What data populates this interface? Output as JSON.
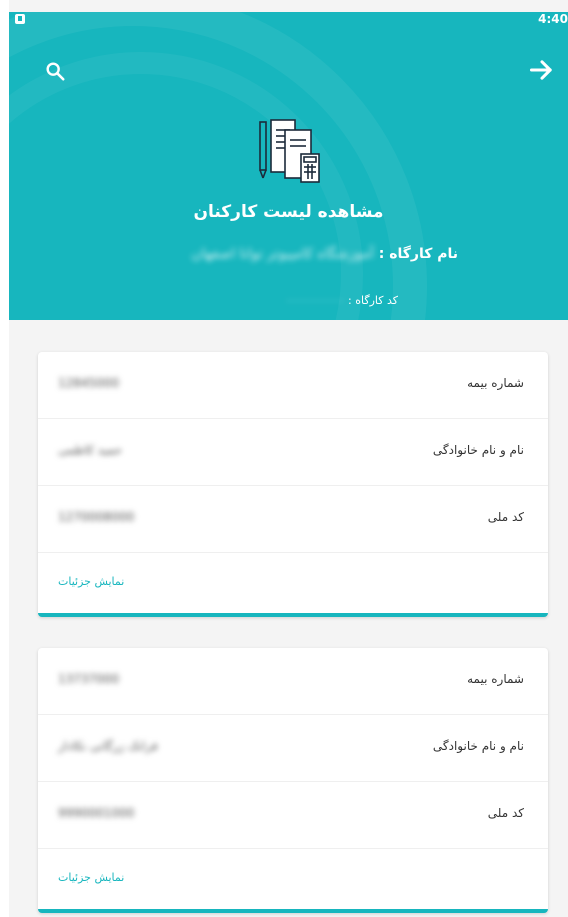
{
  "status": {
    "time": "4:40"
  },
  "header": {
    "title": "مشاهده لیست کارکنان",
    "workshop_name_label": "نام کارگاه :",
    "workshop_name_value": "آموزشگاه کامپیوتر توانا اصفهان",
    "workshop_code_label": "کد کارگاه :",
    "workshop_code_value": "۰۰۰۰۰۰۰۰۰۰"
  },
  "icons": {
    "search": "search-icon",
    "back": "arrow-right-icon",
    "header": "documents-icon"
  },
  "colors": {
    "accent": "#17b6be",
    "background": "#f4f4f4"
  },
  "labels": {
    "insurance_number": "شماره بیمه",
    "full_name": "نام و نام خانوادگی",
    "national_code": "کد ملی",
    "show_details": "نمایش جزئیات"
  },
  "employees": [
    {
      "insurance_number": "12845000",
      "full_name": "حمید کاظمی",
      "national_code": "1270008000"
    },
    {
      "insurance_number": "13737000",
      "full_name": "فرانک زرگانی نکادار",
      "national_code": "9990001000"
    }
  ]
}
